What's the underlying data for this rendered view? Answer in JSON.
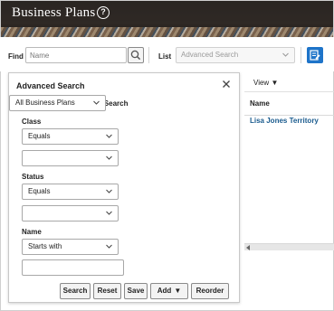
{
  "header": {
    "title": "Business Plans",
    "help_icon": "help-circle-icon"
  },
  "toolbar": {
    "find_label": "Find",
    "find_placeholder": "Name",
    "list_label": "List",
    "list_value": "Advanced Search"
  },
  "advanced_search": {
    "title": "Advanced Search",
    "saved_search_label": "Saved Search",
    "saved_search_value": "All Business Plans",
    "fields": {
      "class": {
        "label": "Class",
        "operator": "Equals",
        "value": ""
      },
      "status": {
        "label": "Status",
        "operator": "Equals",
        "value": ""
      },
      "name": {
        "label": "Name",
        "operator": "Starts with",
        "value": ""
      }
    },
    "buttons": {
      "search": "Search",
      "reset": "Reset",
      "save": "Save",
      "add": "Add",
      "reorder": "Reorder"
    }
  },
  "results": {
    "view_menu": "View",
    "column_name": "Name",
    "rows": [
      "Lisa Jones Territory"
    ]
  },
  "colors": {
    "header_bg": "#2f2925",
    "accent_blue": "#1e74c9",
    "link": "#1a5b8e"
  }
}
